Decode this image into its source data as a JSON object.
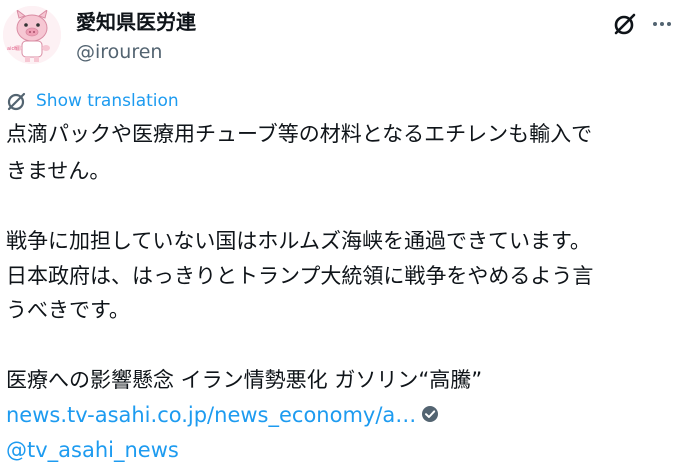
{
  "author": {
    "display_name": "愛知県医労連",
    "handle": "@irouren"
  },
  "icons": {
    "avatar": "pig-mascot-avatar",
    "grok": "grok-icon",
    "more": "more-icon",
    "translate": "translate-icon",
    "verified": "verified-badge-icon"
  },
  "colors": {
    "link": "#1d9bf0",
    "text": "#0f1419",
    "secondary": "#536471"
  },
  "translate_label": "Show translation",
  "body": {
    "lines": [
      "点滴パックや医療用チューブ等の材料となるエチレンも輸入で",
      "きません。",
      "",
      "戦争に加担していない国はホルムズ海峡を通過できています。",
      "日本政府は、はっきりとトランプ大統領に戦争をやめるよう言",
      "うべきです。",
      "",
      "医療への影響懸念 イラン情勢悪化 ガソリン“高騰”"
    ],
    "url": "news.tv-asahi.co.jp/news_economy/a…",
    "mention": "@tv_asahi_news"
  }
}
